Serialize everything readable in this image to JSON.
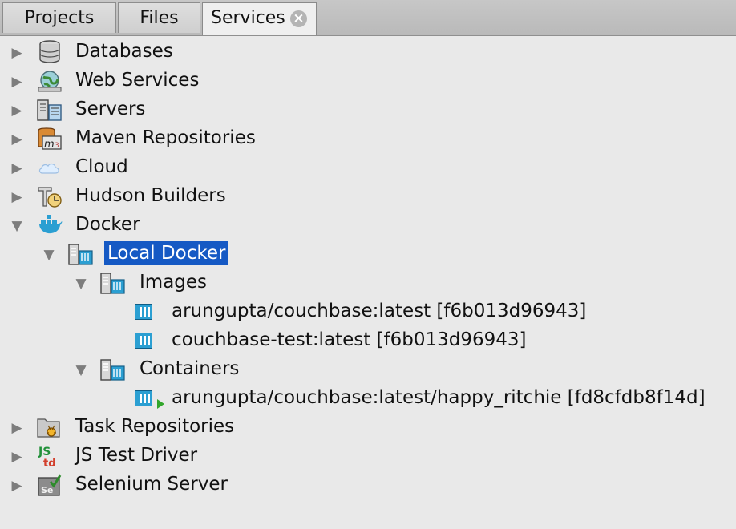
{
  "tabs": [
    {
      "label": "Projects"
    },
    {
      "label": "Files"
    },
    {
      "label": "Services",
      "active": true
    }
  ],
  "tree": {
    "databases": "Databases",
    "web_services": "Web Services",
    "servers": "Servers",
    "maven_repositories": "Maven Repositories",
    "cloud": "Cloud",
    "hudson_builders": "Hudson Builders",
    "docker": "Docker",
    "local_docker": "Local Docker",
    "images": "Images",
    "image_1": "arungupta/couchbase:latest [f6b013d96943]",
    "image_2": "couchbase-test:latest [f6b013d96943]",
    "containers": "Containers",
    "container_1": "arungupta/couchbase:latest/happy_ritchie [fd8cfdb8f14d]",
    "task_repositories": "Task Repositories",
    "js_test_driver": "JS Test Driver",
    "selenium_server": "Selenium Server"
  },
  "colors": {
    "selection": "#1559c4",
    "docker_blue": "#2b9fd2"
  },
  "icons": {
    "close": "close-circle-icon",
    "collapsed": "triangle-right-icon",
    "expanded": "triangle-down-icon"
  }
}
